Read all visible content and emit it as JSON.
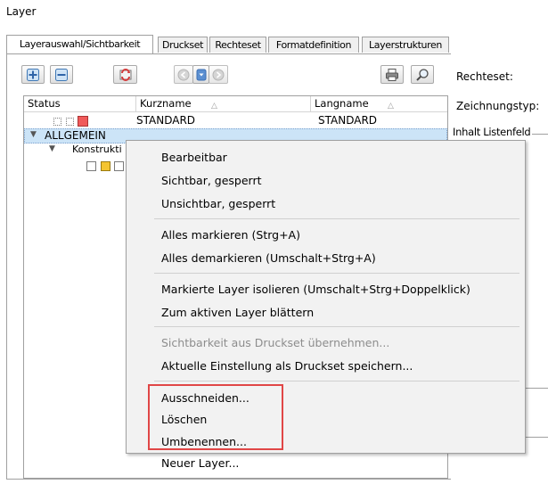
{
  "window": {
    "title": "Layer"
  },
  "tabs": [
    {
      "label": "Layerauswahl/Sichtbarkeit",
      "active": true
    },
    {
      "label": "Druckset",
      "active": false
    },
    {
      "label": "Rechteset",
      "active": false
    },
    {
      "label": "Formatdefinition",
      "active": false
    },
    {
      "label": "Layerstrukturen",
      "active": false
    }
  ],
  "toolbar": {
    "icons": [
      "add-layer-icon",
      "remove-layer-icon",
      "refresh-layers-icon",
      "nav-back-icon",
      "dropdown-icon",
      "nav-forward-icon",
      "print-icon",
      "search-icon"
    ]
  },
  "list": {
    "columns": {
      "status": "Status",
      "kurzname": "Kurzname",
      "langname": "Langname",
      "sort_marker": "△"
    },
    "rows": [
      {
        "kurzname": "STANDARD",
        "langname": "STANDARD"
      },
      {
        "label": "ALLGEMEIN",
        "selected": true
      },
      {
        "label": "Konstrukti"
      }
    ]
  },
  "right_panel": {
    "rechteset_label": "Rechteset:",
    "zeichnungstyp_label": "Zeichnungstyp:",
    "inhalt_label": "Inhalt Listenfeld"
  },
  "context_menu": {
    "groups": [
      [
        "Bearbeitbar",
        "Sichtbar, gesperrt",
        "Unsichtbar, gesperrt"
      ],
      [
        "Alles markieren (Strg+A)",
        "Alles demarkieren (Umschalt+Strg+A)"
      ],
      [
        "Markierte Layer isolieren (Umschalt+Strg+Doppelklick)",
        "Zum aktiven Layer blättern"
      ],
      [
        "Sichtbarkeit aus Druckset übernehmen...",
        "Aktuelle Einstellung als Druckset speichern..."
      ],
      [
        "Ausschneiden...",
        "Löschen",
        "Umbenennen...",
        "Neuer Layer..."
      ]
    ],
    "disabled_items": [
      "Sichtbarkeit aus Druckset übernehmen..."
    ],
    "highlighted_group": 4
  },
  "colors": {
    "selection_bg": "#cce4f7",
    "selection_border": "#7da2ce",
    "status_red": "#f05a5a",
    "status_yellow": "#f4c430",
    "highlight_box": "#e04646",
    "menu_bg": "#f2f2f2"
  }
}
